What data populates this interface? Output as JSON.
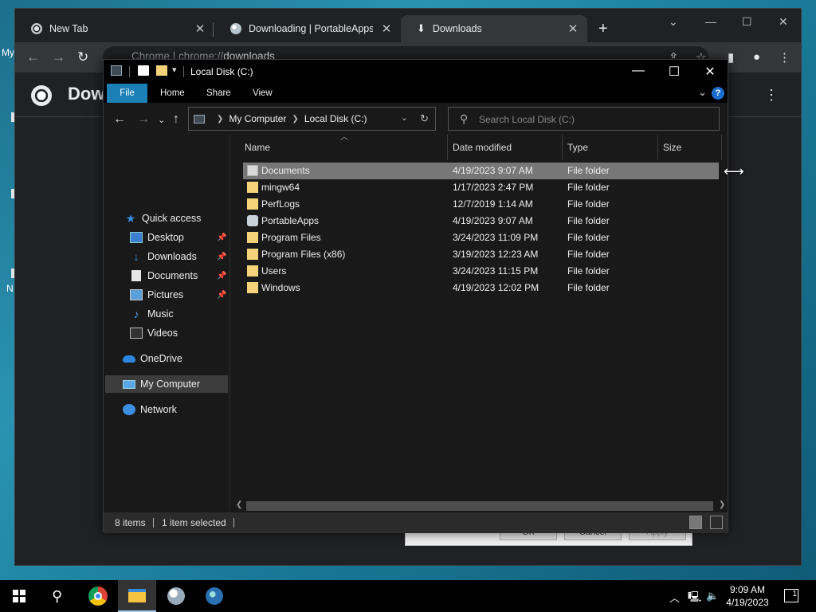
{
  "desktop": {
    "label_my": "My",
    "label_n": "N"
  },
  "chrome": {
    "tabs": [
      {
        "title": "New Tab",
        "icon": "chrome-icon"
      },
      {
        "title": "Downloading | PortableApps.com",
        "icon": "portableapps-icon"
      },
      {
        "title": "Downloads",
        "icon": "download-icon"
      }
    ],
    "close_glyph": "✕",
    "new_tab_glyph": "+",
    "url_scheme": "Chrome  |  chrome://",
    "url_host": "downloads",
    "page_title": "Downloads"
  },
  "behind_dialog": {
    "ok": "OK",
    "cancel": "Cancel",
    "apply": "Apply"
  },
  "explorer": {
    "title": "Local Disk (C:)",
    "ribbon_tabs": [
      "File",
      "Home",
      "Share",
      "View"
    ],
    "help_glyph": "?",
    "breadcrumb": [
      "My Computer",
      "Local Disk (C:)"
    ],
    "search_placeholder": "Search Local Disk (C:)",
    "nav_pane": [
      {
        "label": "Quick access",
        "icon": "star-icon",
        "pinned": false
      },
      {
        "label": "Desktop",
        "icon": "desktop-icon",
        "pinned": true
      },
      {
        "label": "Downloads",
        "icon": "downloads-icon",
        "pinned": true
      },
      {
        "label": "Documents",
        "icon": "documents-icon",
        "pinned": true
      },
      {
        "label": "Pictures",
        "icon": "pictures-icon",
        "pinned": true
      },
      {
        "label": "Music",
        "icon": "music-icon",
        "pinned": false
      },
      {
        "label": "Videos",
        "icon": "videos-icon",
        "pinned": false
      },
      {
        "label": "OneDrive",
        "icon": "cloud-icon",
        "pinned": false
      },
      {
        "label": "My Computer",
        "icon": "computer-icon",
        "pinned": false,
        "selected": true
      },
      {
        "label": "Network",
        "icon": "network-icon",
        "pinned": false
      }
    ],
    "columns": [
      "Name",
      "Date modified",
      "Type",
      "Size"
    ],
    "files": [
      {
        "name": "Documents",
        "date": "4/19/2023 9:07 AM",
        "type": "File folder",
        "selected": true
      },
      {
        "name": "mingw64",
        "date": "1/17/2023 2:47 PM",
        "type": "File folder"
      },
      {
        "name": "PerfLogs",
        "date": "12/7/2019 1:14 AM",
        "type": "File folder"
      },
      {
        "name": "PortableApps",
        "date": "4/19/2023 9:07 AM",
        "type": "File folder"
      },
      {
        "name": "Program Files",
        "date": "3/24/2023 11:09 PM",
        "type": "File folder"
      },
      {
        "name": "Program Files (x86)",
        "date": "3/19/2023 12:23 AM",
        "type": "File folder"
      },
      {
        "name": "Users",
        "date": "3/24/2023 11:15 PM",
        "type": "File folder"
      },
      {
        "name": "Windows",
        "date": "4/19/2023 12:02 PM",
        "type": "File folder"
      }
    ],
    "status": {
      "items": "8 items",
      "selected": "1 item selected"
    }
  },
  "taskbar": {
    "time": "9:09 AM",
    "date": "4/19/2023",
    "notifications": "1"
  }
}
